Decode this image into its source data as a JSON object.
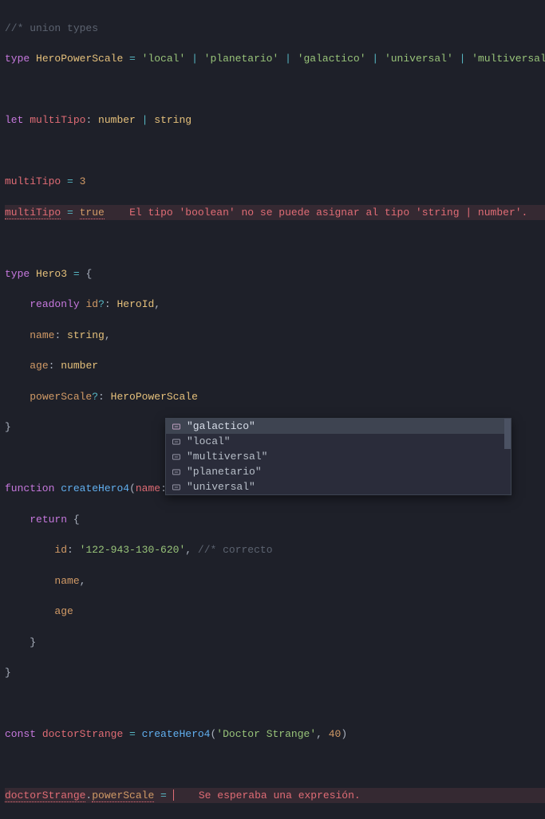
{
  "code": {
    "comment_union": "//* union types",
    "type_kw": "type",
    "heroPowerScale_name": "HeroPowerScale",
    "eq": " = ",
    "union_vals": {
      "local": "'local'",
      "planetario": "'planetario'",
      "galactico": "'galactico'",
      "universal": "'universal'",
      "multiversal": "'multiversal'"
    },
    "pipe": " | ",
    "let_kw": "let",
    "multiTipo_name": "multiTipo",
    "colon": ": ",
    "number_type": "number",
    "string_type": "string",
    "assign_3": " = ",
    "val_3": "3",
    "assign_true": " = ",
    "val_true": "true",
    "err1": "El tipo 'boolean' no se puede asignar al tipo 'string | number'.",
    "hero3_name": "Hero3",
    "brace_open": "{",
    "brace_close": "}",
    "readonly_kw": "readonly",
    "id_prop": "id",
    "opt": "?",
    "heroId_type": "HeroId",
    "comma": ",",
    "name_prop": "name",
    "age_prop": "age",
    "powerScale_prop": "powerScale",
    "function_kw": "function",
    "createHero4_name": "createHero4",
    "paren_open": "(",
    "paren_close": ")",
    "colon_ret": ": ",
    "return_kw": "return",
    "id_field": "id",
    "id_val": "'122-943-130-620'",
    "comment_correcto": "//* correcto",
    "name_field": "name",
    "age_field": "age",
    "const_kw": "const",
    "doctorStrange_name": "doctorStrange",
    "ds_str": "'Doctor Strange'",
    "ds_age": "40",
    "dot": ".",
    "powerScale_field": "powerScale",
    "err2": "Se esperaba una expresión."
  },
  "autocomplete": {
    "items": [
      "\"galactico\"",
      "\"local\"",
      "\"multiversal\"",
      "\"planetario\"",
      "\"universal\""
    ]
  }
}
